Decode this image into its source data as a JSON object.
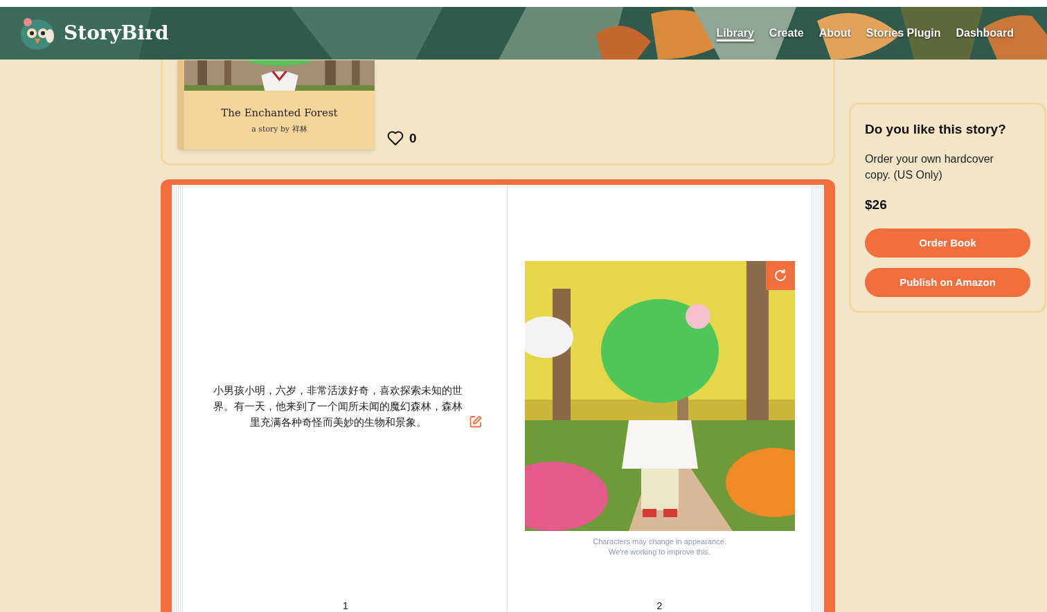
{
  "header": {
    "logo": "StoryBird",
    "nav": [
      {
        "label": "Library",
        "selected": true
      },
      {
        "label": "Create",
        "selected": false
      },
      {
        "label": "About",
        "selected": false
      },
      {
        "label": "Stories Plugin",
        "selected": false
      },
      {
        "label": "Dashboard",
        "selected": false
      }
    ]
  },
  "story_card": {
    "title": "The Enchanted Forest",
    "byline": "a story by 祥林",
    "likes": "0"
  },
  "book": {
    "pages": [
      {
        "kind": "text",
        "text": "小男孩小明，六岁，非常活泼好奇，喜欢探索未知的世界。有一天，他来到了一个闻所未闻的魔幻森林，森林里充满各种奇怪而美妙的生物和景象。",
        "number": "1"
      },
      {
        "caption": "Characters may change in appearance.\nWe're working to improve this.",
        "number": "2"
      }
    ]
  },
  "order_card": {
    "title": "Do you like this story?",
    "text": "Order your own hardcover copy. (US Only)",
    "price": "$26",
    "buttons": [
      "Order Book",
      "Publish on Amazon"
    ]
  }
}
